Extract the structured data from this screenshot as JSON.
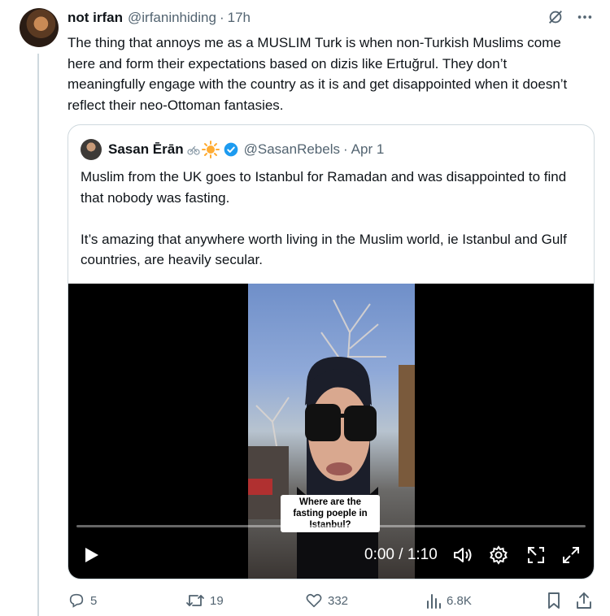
{
  "tweet": {
    "author_name": "not irfan",
    "author_handle": "@irfaninhiding",
    "separator": "·",
    "time": "17h",
    "text": "The thing that annoys me as a MUSLIM Turk is when non-Turkish Muslims come here and form their expectations based on dizis like Ertuğrul. They don’t meaningfully engage with the country as it is and get disappointed when it doesn’t reflect their neo-Ottoman fantasies."
  },
  "quote": {
    "author_name": "Sasan Ērān",
    "author_handle": "@SasanRebels",
    "separator": "·",
    "time": "Apr 1",
    "text": "Muslim from the UK goes to Istanbul for Ramadan and was disappointed to find that nobody was fasting.\n\nIt’s amazing that anywhere worth living in the Muslim world, ie Istanbul and Gulf countries, are heavily secular.",
    "video": {
      "caption": "Where are the fasting poeple in Istanbul?",
      "time_display": "0:00 / 1:10",
      "progress": 0
    }
  },
  "actions": {
    "replies": "5",
    "reposts": "19",
    "likes": "332",
    "views": "6.8K"
  },
  "icons": {
    "more": "more-icon",
    "grok": "grok-icon",
    "verified": "verified-badge-icon",
    "play": "play-icon",
    "volume": "volume-icon",
    "settings": "settings-icon",
    "pip": "pip-icon",
    "fullscreen": "fullscreen-icon",
    "reply": "reply-icon",
    "repost": "repost-icon",
    "like": "like-icon",
    "views": "views-icon",
    "bookmark": "bookmark-icon",
    "share": "share-icon"
  },
  "colors": {
    "text": "#0f1419",
    "secondary": "#536471",
    "border": "#cfd9de",
    "verified": "#1d9bf0"
  }
}
